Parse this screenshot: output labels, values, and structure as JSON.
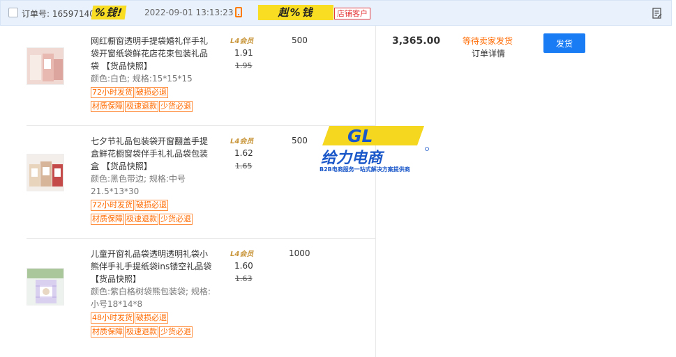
{
  "header": {
    "order_label": "订单号: 16597140",
    "sticker_a": "%钱!",
    "order_time": "2022-09-01 13:13:23",
    "sticker_b": "赳%钱",
    "store_badge": "店铺客户"
  },
  "items": [
    {
      "title": "网红橱窗透明手提袋婚礼伴手礼袋开窗纸袋鲜花店花束包装礼品袋 【货品快照】",
      "spec": "颜色:白色; 规格:15*15*15",
      "tags": [
        "72小时发货",
        "破损必退",
        "材质保障",
        "极速退款",
        "少货必退"
      ],
      "level": "L4会员",
      "price": "1.91",
      "original_price": "1.95",
      "quantity": "500"
    },
    {
      "title": "七夕节礼品包装袋开窗翻盖手提盒鲜花橱窗袋伴手礼礼品袋包装盒 【货品快照】",
      "spec": "颜色:黑色带边; 规格:中号21.5*13*30",
      "tags": [
        "72小时发货",
        "破损必退",
        "材质保障",
        "极速退款",
        "少货必退"
      ],
      "level": "L4会员",
      "price": "1.62",
      "original_price": "1.65",
      "quantity": "500"
    },
    {
      "title": "儿童开窗礼品袋透明透明礼袋小熊伴手礼手提纸袋ins镂空礼品袋 【货品快照】",
      "spec": "颜色:紫白格树袋熊包装袋; 规格:小号18*14*8",
      "tags": [
        "48小时发货",
        "破损必退",
        "材质保障",
        "极速退款",
        "少货必退"
      ],
      "level": "L4会员",
      "price": "1.60",
      "original_price": "1.63",
      "quantity": "1000"
    }
  ],
  "order": {
    "total": "3,365.00",
    "status": "等待卖家发货",
    "detail_link": "订单详情",
    "ship_button": "发货"
  },
  "watermark": {
    "logo": "GL",
    "name": "给力电商",
    "tagline": "B2B电商服务一站式解决方案提供商"
  },
  "colors": {
    "header_bg": "#e9f1fc",
    "accent_orange": "#ff6a00",
    "ship_button": "#1a7cf5",
    "sticker_yellow": "#f8dd23"
  }
}
